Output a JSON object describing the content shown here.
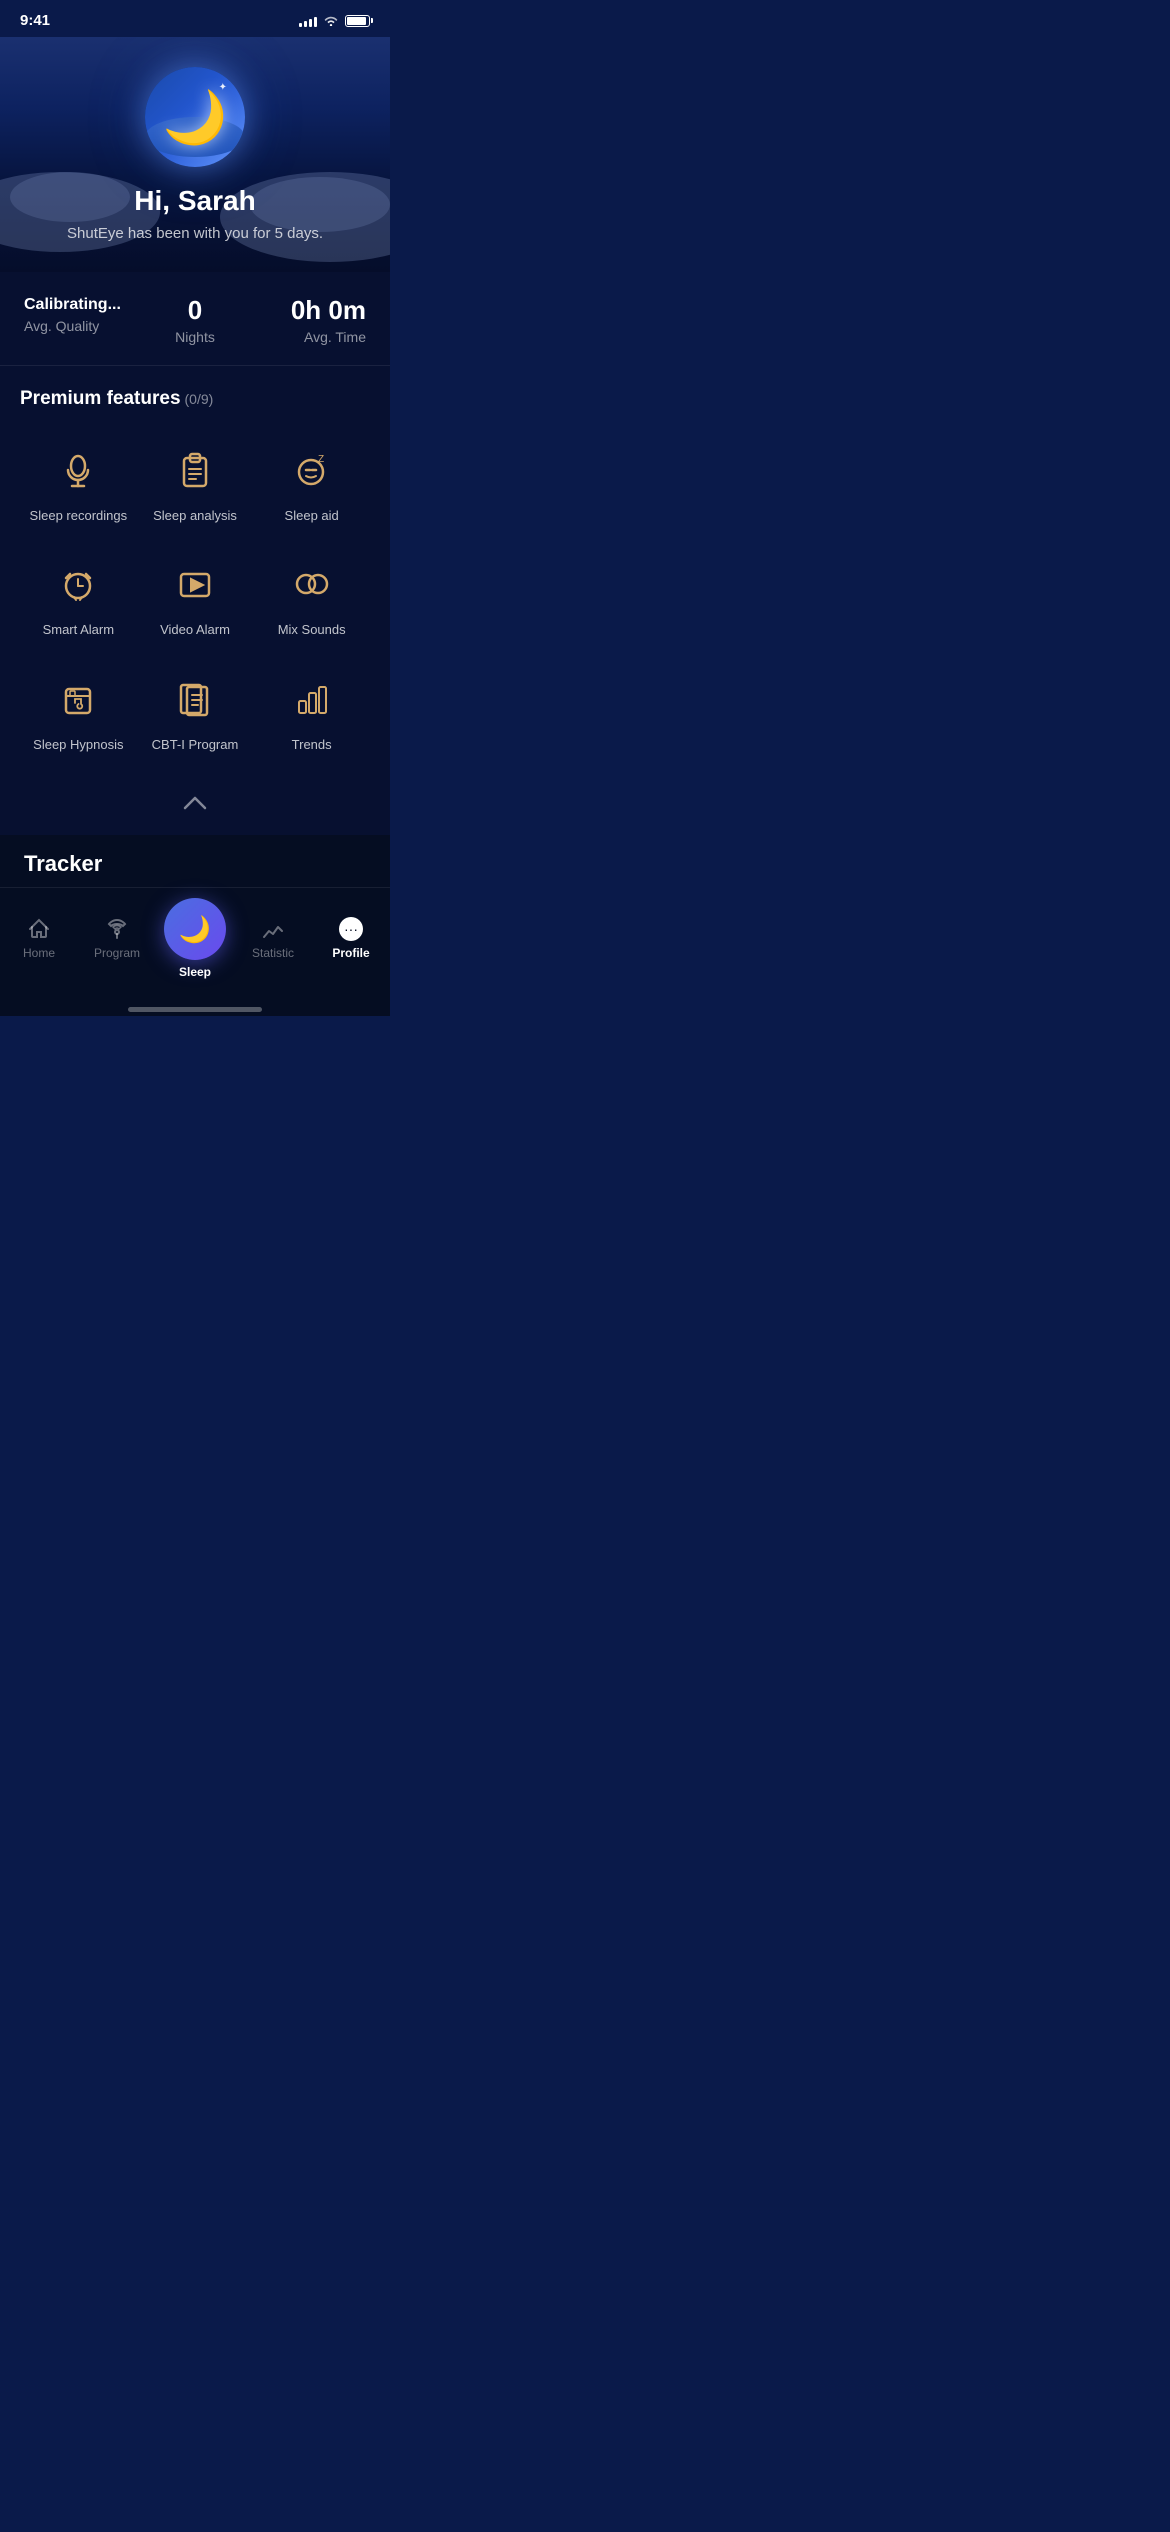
{
  "statusBar": {
    "time": "9:41"
  },
  "hero": {
    "greeting": "Hi, Sarah",
    "subtitle": "ShutEye has been with you for 5 days."
  },
  "stats": {
    "avgQualityLabel": "Avg. Quality",
    "avgQualityValue": "Calibrating...",
    "nightsValue": "0",
    "nightsLabel": "Nights",
    "avgTimeValue": "0h 0m",
    "avgTimeLabel": "Avg. Time"
  },
  "premiumFeatures": {
    "title": "Premium features",
    "badge": "(0/9)",
    "items": [
      {
        "id": "sleep-recordings",
        "label": "Sleep recordings"
      },
      {
        "id": "sleep-analysis",
        "label": "Sleep analysis"
      },
      {
        "id": "sleep-aid",
        "label": "Sleep aid"
      },
      {
        "id": "smart-alarm",
        "label": "Smart Alarm"
      },
      {
        "id": "video-alarm",
        "label": "Video Alarm"
      },
      {
        "id": "mix-sounds",
        "label": "Mix Sounds"
      },
      {
        "id": "sleep-hypnosis",
        "label": "Sleep Hypnosis"
      },
      {
        "id": "cbti-program",
        "label": "CBT-I Program"
      },
      {
        "id": "trends",
        "label": "Trends"
      }
    ]
  },
  "tracker": {
    "title": "Tracker"
  },
  "bottomNav": {
    "items": [
      {
        "id": "home",
        "label": "Home",
        "active": false
      },
      {
        "id": "program",
        "label": "Program",
        "active": false
      },
      {
        "id": "sleep",
        "label": "Sleep",
        "active": true,
        "center": true
      },
      {
        "id": "statistic",
        "label": "Statistic",
        "active": false
      },
      {
        "id": "profile",
        "label": "Profile",
        "active": true
      }
    ]
  }
}
